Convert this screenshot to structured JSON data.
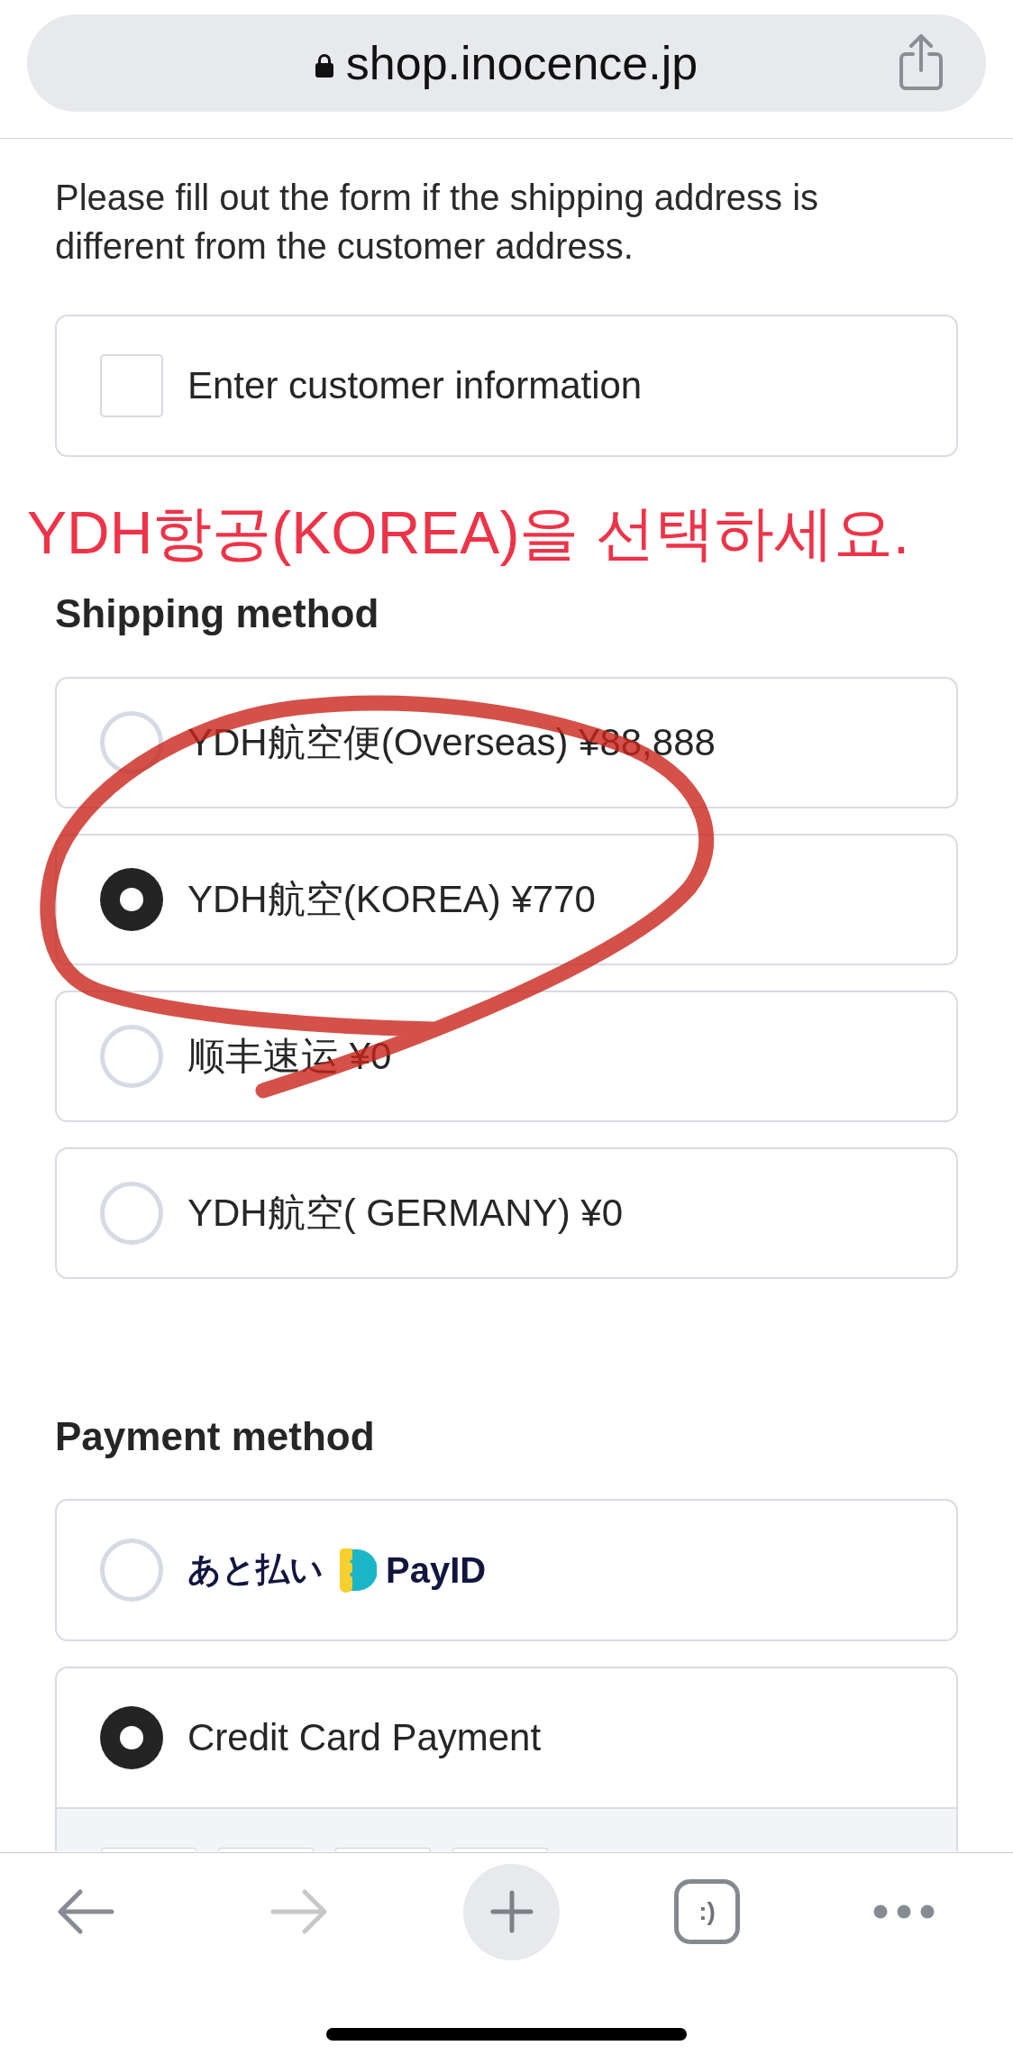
{
  "browser": {
    "url": "shop.inocence.jp"
  },
  "notice": "Please fill out the form if the shipping address is different from the customer address.",
  "customer_option": {
    "label": "Enter customer information",
    "checked": false
  },
  "instruction": "YDH항공(KOREA)을 선택하세요.",
  "shipping": {
    "heading": "Shipping method",
    "options": [
      {
        "label": "YDH航空便(Overseas) ¥88,888",
        "selected": false
      },
      {
        "label": "YDH航空(KOREA) ¥770",
        "selected": true
      },
      {
        "label": "顺丰速运 ¥0",
        "selected": false
      },
      {
        "label": "YDH航空( GERMANY) ¥0",
        "selected": false
      }
    ]
  },
  "payment": {
    "heading": "Payment method",
    "options": [
      {
        "kind": "logo",
        "label": "あと払い",
        "brand": "PayID",
        "selected": false,
        "expanded": false
      },
      {
        "kind": "text",
        "label": "Credit Card Payment",
        "selected": true,
        "expanded": true
      }
    ]
  },
  "toolbar": {
    "buttons": [
      {
        "kind": "back",
        "disabled": false
      },
      {
        "kind": "forward",
        "disabled": true
      },
      {
        "kind": "new-tab"
      },
      {
        "kind": "tabs",
        "label": ":)"
      },
      {
        "kind": "menu"
      }
    ]
  }
}
